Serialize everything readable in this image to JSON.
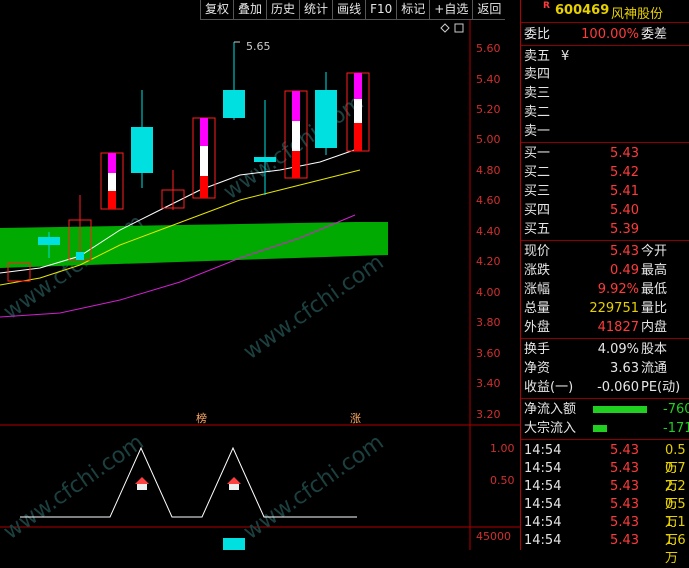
{
  "toolbar": {
    "items": [
      "复权",
      "叠加",
      "历史",
      "统计",
      "画线",
      "F10",
      "标记",
      "+自选",
      "返回"
    ]
  },
  "chart": {
    "peak_label": "5.65",
    "price_ticks": [
      "5.60",
      "5.40",
      "5.20",
      "5.00",
      "4.80",
      "4.60",
      "4.40",
      "4.20",
      "4.00",
      "3.80",
      "3.60",
      "3.40",
      "3.20"
    ],
    "ind_ticks": [
      "1.00",
      "0.50"
    ],
    "vol_tick": "45000",
    "marker_bang": "榜",
    "marker_zhang": "涨",
    "watermark": "www.cfchi.com",
    "colors": {
      "up": "#ff2020",
      "down": "#00e0e0",
      "ma1": "#ffffff",
      "ma2": "#e6e600",
      "ma3": "#d020d0",
      "band": "#00aa00"
    }
  },
  "panel": {
    "r_badge": "R",
    "code": "600469",
    "name": "风神股份",
    "weibi_label": "委比",
    "weibi_value": "100.00%",
    "weicha_label": "委差",
    "sell": [
      {
        "label": "卖五",
        "extra": "¥"
      },
      {
        "label": "卖四",
        "extra": ""
      },
      {
        "label": "卖三",
        "extra": ""
      },
      {
        "label": "卖二",
        "extra": ""
      },
      {
        "label": "卖一",
        "extra": ""
      }
    ],
    "buy": [
      {
        "label": "买一",
        "value": "5.43"
      },
      {
        "label": "买二",
        "value": "5.42"
      },
      {
        "label": "买三",
        "value": "5.41"
      },
      {
        "label": "买四",
        "value": "5.40"
      },
      {
        "label": "买五",
        "value": "5.39"
      }
    ],
    "stats1": [
      {
        "label": "现价",
        "value": "5.43",
        "label2": "今开"
      },
      {
        "label": "涨跌",
        "value": "0.49",
        "label2": "最高"
      },
      {
        "label": "涨幅",
        "value": "9.92%",
        "label2": "最低"
      },
      {
        "label": "总量",
        "value": "229751",
        "label2": "量比"
      },
      {
        "label": "外盘",
        "value": "41827",
        "label2": "内盘"
      }
    ],
    "stats2": [
      {
        "label": "换手",
        "value": "4.09%",
        "label2": "股本"
      },
      {
        "label": "净资",
        "value": "3.63",
        "label2": "流通"
      },
      {
        "label": "收益(一)",
        "value": "-0.060",
        "label2": "PE(动)"
      }
    ],
    "flow": [
      {
        "label": "净流入额",
        "value": "-760"
      },
      {
        "label": "大宗流入",
        "value": "-171"
      }
    ],
    "ticks": [
      {
        "time": "14:54",
        "price": "5.43",
        "vol": "0.5万"
      },
      {
        "time": "14:54",
        "price": "5.43",
        "vol": "0.7万"
      },
      {
        "time": "14:54",
        "price": "5.43",
        "vol": "2.2万"
      },
      {
        "time": "14:54",
        "price": "5.43",
        "vol": "0.5万"
      },
      {
        "time": "14:54",
        "price": "5.43",
        "vol": "1.1万"
      },
      {
        "time": "14:54",
        "price": "5.43",
        "vol": "1.6万"
      }
    ]
  }
}
